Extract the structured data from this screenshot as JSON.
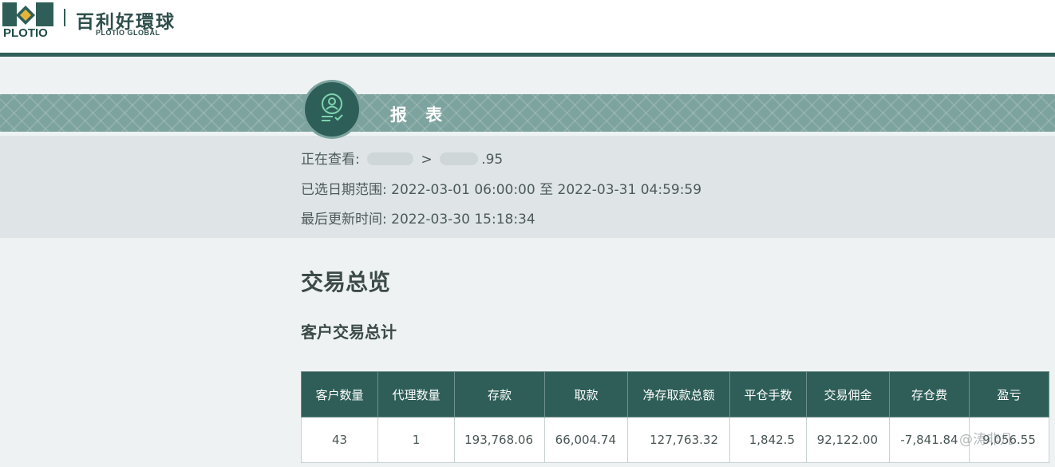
{
  "brand": {
    "wordmark": "PLOTIO",
    "name_cn": "百利好環球",
    "name_en": "PLOTIO GLOBAL",
    "colors": {
      "primary": "#2f5e58",
      "band": "#7da39f",
      "accent": "#e4b43a"
    }
  },
  "report": {
    "title": "报 表",
    "icon": "user-checklist-icon",
    "viewing_label": "正在查看:",
    "viewing_separator": ">",
    "viewing_suffix": ".95",
    "date_range_label": "已选日期范围:",
    "date_range_start": "2022-03-01 06:00:00",
    "date_range_to": "至",
    "date_range_end": "2022-03-31 04:59:59",
    "last_update_label": "最后更新时间:",
    "last_update_value": "2022-03-30 15:18:34"
  },
  "section_title": "交易总览",
  "subsection_title": "客户交易总计",
  "table": {
    "headers": [
      "客户数量",
      "代理数量",
      "存款",
      "取款",
      "净存取款总额",
      "平仓手数",
      "交易佣金",
      "存仓费",
      "盈亏"
    ],
    "rows": [
      [
        "43",
        "1",
        "193,768.06",
        "66,004.74",
        "127,763.32",
        "1,842.5",
        "92,122.00",
        "-7,841.84",
        "9,056.55"
      ]
    ]
  },
  "watermark": "@涛非凡"
}
